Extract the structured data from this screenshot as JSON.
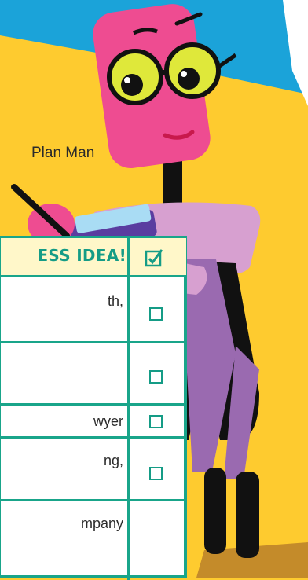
{
  "character": {
    "name": "Plan Man"
  },
  "checklist": {
    "header_title": "ESS IDEA!",
    "header_check_icon": "checked-box-icon",
    "rows": [
      {
        "text": "th,",
        "checked": false
      },
      {
        "text": "",
        "checked": false
      },
      {
        "text": "wyer",
        "checked": false
      },
      {
        "text": "ng,",
        "checked": false
      },
      {
        "text": "mpany",
        "checked": false
      }
    ]
  },
  "colors": {
    "background_yellow": "#fecb2f",
    "sky_blue": "#1ba3d9",
    "teal": "#19a58a",
    "pink": "#ee4c91",
    "lavender": "#d7a0d0",
    "purple": "#9a6ab0",
    "lime": "#dfe83a"
  }
}
